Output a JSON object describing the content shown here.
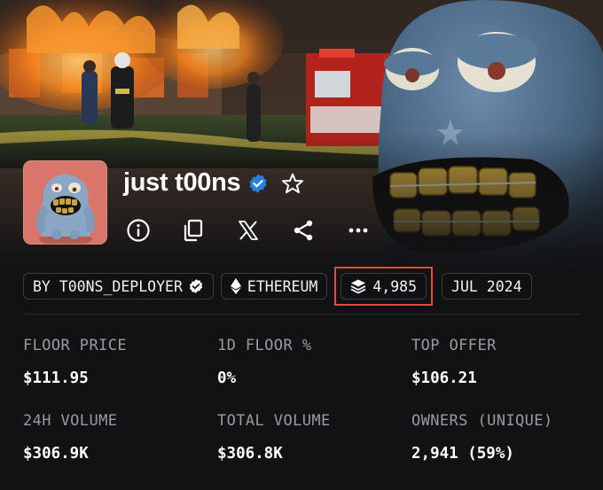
{
  "collection": {
    "name": "just t00ns",
    "verified": true
  },
  "actions": [
    {
      "name": "info",
      "icon": "info-icon"
    },
    {
      "name": "copy",
      "icon": "copy-icon"
    },
    {
      "name": "x",
      "icon": "x-logo-icon"
    },
    {
      "name": "share",
      "icon": "share-icon"
    },
    {
      "name": "more",
      "icon": "more-icon"
    }
  ],
  "chips": {
    "creator": "BY T00NS_DEPLOYER",
    "chain": "ETHEREUM",
    "items": "4,985",
    "date": "JUL 2024"
  },
  "stats": {
    "floor_price": {
      "label": "FLOOR PRICE",
      "value": "$111.95"
    },
    "floor_change": {
      "label": "1D FLOOR %",
      "value": "0%"
    },
    "top_offer": {
      "label": "TOP OFFER",
      "value": "$106.21"
    },
    "volume_24h": {
      "label": "24H VOLUME",
      "value": "$306.9K"
    },
    "total_volume": {
      "label": "TOTAL VOLUME",
      "value": "$306.8K"
    },
    "owners": {
      "label": "OWNERS (UNIQUE)",
      "value": "2,941 (59%)"
    }
  },
  "colors": {
    "background": "#121214",
    "highlight": "#e5493b",
    "verified": "#2081e2",
    "muted_text": "#9a9aa0"
  }
}
